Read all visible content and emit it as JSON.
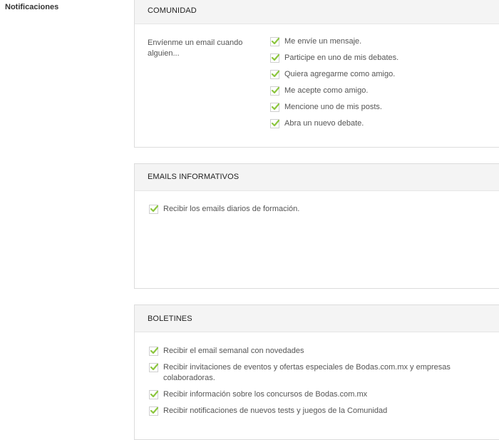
{
  "sidebar": {
    "title": "Notificaciones"
  },
  "colors": {
    "check": "#8cc63f",
    "header_bg": "#f4f4f4",
    "border": "#dcdcdc"
  },
  "sections": {
    "comunidad": {
      "header": "COMUNIDAD",
      "intro": "Envíenme un email cuando alguien...",
      "options": [
        {
          "label": "Me envíe un mensaje.",
          "checked": true
        },
        {
          "label": "Participe en uno de mis debates.",
          "checked": true
        },
        {
          "label": "Quiera agregarme como amigo.",
          "checked": true
        },
        {
          "label": "Me acepte como amigo.",
          "checked": true
        },
        {
          "label": "Mencione uno de mis posts.",
          "checked": true
        },
        {
          "label": "Abra un nuevo debate.",
          "checked": true
        }
      ]
    },
    "emails_informativos": {
      "header": "EMAILS INFORMATIVOS",
      "options": [
        {
          "label": "Recibir los emails diarios de formación.",
          "checked": true
        }
      ]
    },
    "boletines": {
      "header": "BOLETINES",
      "options": [
        {
          "label": "Recibir el email semanal con novedades",
          "checked": true
        },
        {
          "label": "Recibir invitaciones de eventos y ofertas especiales de Bodas.com.mx y empresas colaboradoras.",
          "checked": true
        },
        {
          "label": "Recibir información sobre los concursos de Bodas.com.mx",
          "checked": true
        },
        {
          "label": "Recibir notificaciones de nuevos tests y juegos de la Comunidad",
          "checked": true
        }
      ]
    }
  }
}
